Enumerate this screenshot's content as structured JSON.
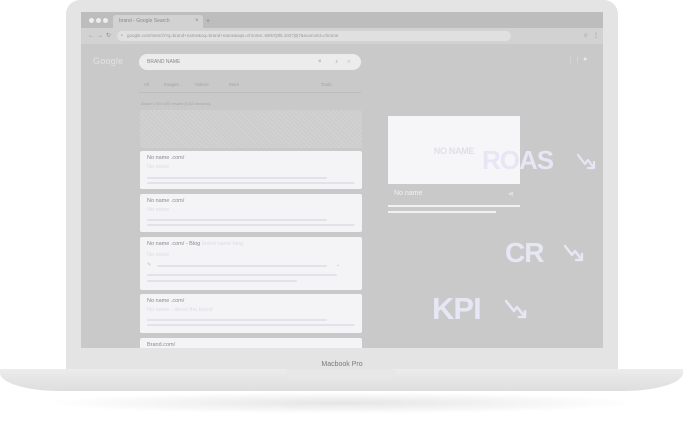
{
  "device": {
    "label": "Macbook Pro"
  },
  "browser": {
    "tab_title": "brand - Google Search",
    "tab_close": "×",
    "new_tab": "+",
    "url": "google.com/search?q=brand+name&oq=brand+name&aqs=chrome..69i57j0l5.1027j0j7&sourceid=chrome",
    "nav": {
      "back": "←",
      "forward": "→",
      "reload": "↻"
    },
    "menu_dots": "⋮",
    "bookmark": "☆"
  },
  "google": {
    "logo": "Google",
    "query": "BRAND NAME",
    "tabs": [
      "All",
      "Images",
      "Videos",
      "More",
      "Tools"
    ],
    "results_info": "About 1 000 000 results (0.52 seconds)",
    "results": [
      {
        "title": "No name .com/",
        "subtitle": "No name"
      },
      {
        "title": "No name .com/",
        "subtitle": "No name"
      },
      {
        "title": "No name .com/ - Blog",
        "title_extra": "brand name blog",
        "subtitle": "No name"
      },
      {
        "title": "No name .com/",
        "subtitle": "No name - about the brand"
      },
      {
        "title": "Brand.com/"
      }
    ]
  },
  "knowledge_panel": {
    "image_label": "NO NAME",
    "title": "No name"
  },
  "metrics": [
    {
      "label": "ROAS",
      "trend": "down"
    },
    {
      "label": "CR",
      "trend": "down"
    },
    {
      "label": "KPI",
      "trend": "down"
    }
  ],
  "colors": {
    "metric_text": "#e6e6f4",
    "card_bg": "#f4f4f6",
    "screen_bg": "#c9c9c9"
  }
}
